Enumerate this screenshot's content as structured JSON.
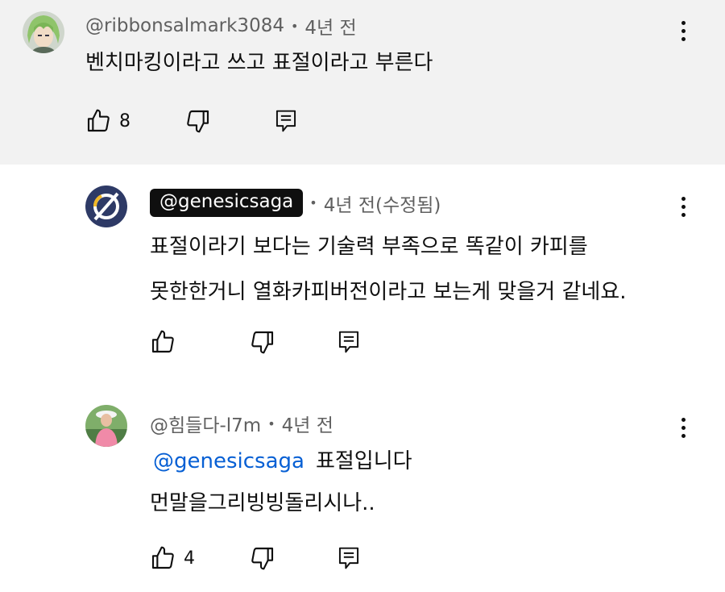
{
  "comments": [
    {
      "handle": "@ribbonsalmark3084",
      "time": "4년 전",
      "text_lines": [
        "벤치마킹이라고 쓰고 표절이라고 부른다"
      ],
      "like_count": "8",
      "avatar_icon": "anime-avatar"
    },
    {
      "handle": "@genesicsaga",
      "time": "4년 전(수정됨)",
      "text_lines": [
        "표절이라기 보다는 기술력 부족으로 똑같이 카피를",
        "못한한거니 열화카피버전이라고 보는게 맞을거 같네요."
      ],
      "like_count": "",
      "avatar_icon": "slashed-circle-logo-avatar"
    },
    {
      "handle": "@힘들다-l7m",
      "time": "4년 전",
      "mention": "@genesicsaga",
      "text_first": "표절입니다",
      "text_second": "먼말을그리빙빙돌리시나..",
      "like_count": "4",
      "avatar_icon": "person-photo-avatar"
    }
  ],
  "colors": {
    "highlight_bg": "#f2f2f2",
    "meta_text": "#606060",
    "mention": "#065fd4",
    "badge_bg": "#0f0f0f"
  },
  "icons": [
    "like-icon",
    "dislike-icon",
    "reply-icon",
    "more-vert-icon"
  ]
}
